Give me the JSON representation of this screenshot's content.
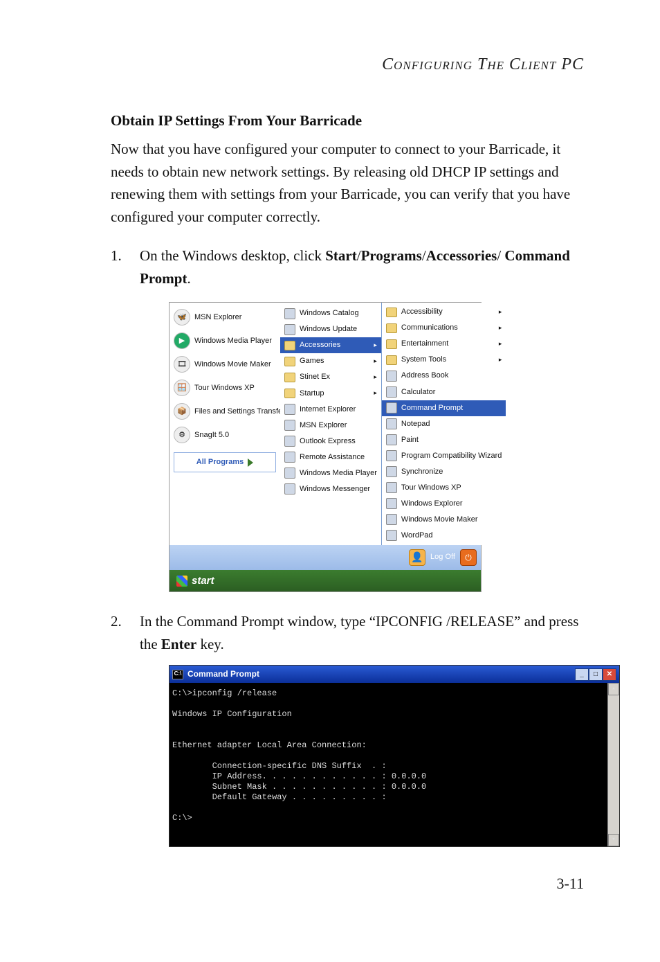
{
  "running_head": "Configuring The Client PC",
  "section_title": "Obtain IP Settings From Your Barricade",
  "intro_paragraph": "Now that you have configured your computer to connect to your Barricade, it needs to obtain new network settings. By releasing old DHCP IP settings and renewing them with settings from your Barricade, you can verify that you have configured your computer correctly.",
  "step1": {
    "num": "1.",
    "pre": "On the Windows desktop, click ",
    "b1": "Start",
    "s1": "/",
    "b2": "Programs",
    "s2": "/",
    "b3": "Accessories",
    "s3": "/ ",
    "b4": "Command Prompt",
    "post": "."
  },
  "step2": {
    "num": "2.",
    "pre": "In the Command Prompt window, type “IPCONFIG /RELEASE” and press the ",
    "b1": "Enter",
    "post": " key."
  },
  "page_number": "3-11",
  "startmenu": {
    "left_items": [
      "MSN Explorer",
      "Windows Media Player",
      "Windows Movie Maker",
      "Tour Windows XP",
      "Files and Settings Transfer Wizard",
      "SnagIt 5.0"
    ],
    "all_programs": "All Programs",
    "mid_items": [
      "Windows Catalog",
      "Windows Update",
      "Accessories",
      "Games",
      "Stinet Ex",
      "Startup",
      "Internet Explorer",
      "MSN Explorer",
      "Outlook Express",
      "Remote Assistance",
      "Windows Media Player",
      "Windows Messenger"
    ],
    "mid_selected_index": 2,
    "right_items": [
      "Accessibility",
      "Communications",
      "Entertainment",
      "System Tools",
      "Address Book",
      "Calculator",
      "Command Prompt",
      "Notepad",
      "Paint",
      "Program Compatibility Wizard",
      "Synchronize",
      "Tour Windows XP",
      "Windows Explorer",
      "Windows Movie Maker",
      "WordPad"
    ],
    "right_selected_index": 6,
    "logoff_label": "Log Off",
    "start_label": "start"
  },
  "cmd": {
    "title": "Command Prompt",
    "lines": [
      "C:\\>ipconfig /release",
      "",
      "Windows IP Configuration",
      "",
      "",
      "Ethernet adapter Local Area Connection:",
      "",
      "        Connection-specific DNS Suffix  . :",
      "        IP Address. . . . . . . . . . . . : 0.0.0.0",
      "        Subnet Mask . . . . . . . . . . . : 0.0.0.0",
      "        Default Gateway . . . . . . . . . :",
      "",
      "C:\\>"
    ]
  }
}
